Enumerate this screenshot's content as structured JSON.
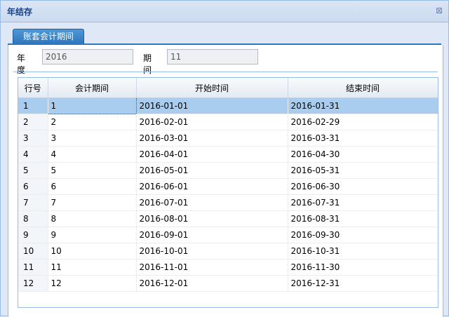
{
  "window": {
    "title": "年结存",
    "close_glyph": "⊠"
  },
  "tab": {
    "label": "账套会计期间"
  },
  "form": {
    "year_label": "年度",
    "year_value": "2016",
    "period_label": "期间",
    "period_value": "11"
  },
  "grid": {
    "headers": [
      "行号",
      "会计期间",
      "开始时间",
      "结束时间"
    ],
    "selected_row": 0,
    "rows": [
      [
        "1",
        "1",
        "2016-01-01",
        "2016-01-31"
      ],
      [
        "2",
        "2",
        "2016-02-01",
        "2016-02-29"
      ],
      [
        "3",
        "3",
        "2016-03-01",
        "2016-03-31"
      ],
      [
        "4",
        "4",
        "2016-04-01",
        "2016-04-30"
      ],
      [
        "5",
        "5",
        "2016-05-01",
        "2016-05-31"
      ],
      [
        "6",
        "6",
        "2016-06-01",
        "2016-06-30"
      ],
      [
        "7",
        "7",
        "2016-07-01",
        "2016-07-31"
      ],
      [
        "8",
        "8",
        "2016-08-01",
        "2016-08-31"
      ],
      [
        "9",
        "9",
        "2016-09-01",
        "2016-09-30"
      ],
      [
        "10",
        "10",
        "2016-10-01",
        "2016-10-31"
      ],
      [
        "11",
        "11",
        "2016-11-01",
        "2016-11-30"
      ],
      [
        "12",
        "12",
        "2016-12-01",
        "2016-12-31"
      ]
    ]
  }
}
